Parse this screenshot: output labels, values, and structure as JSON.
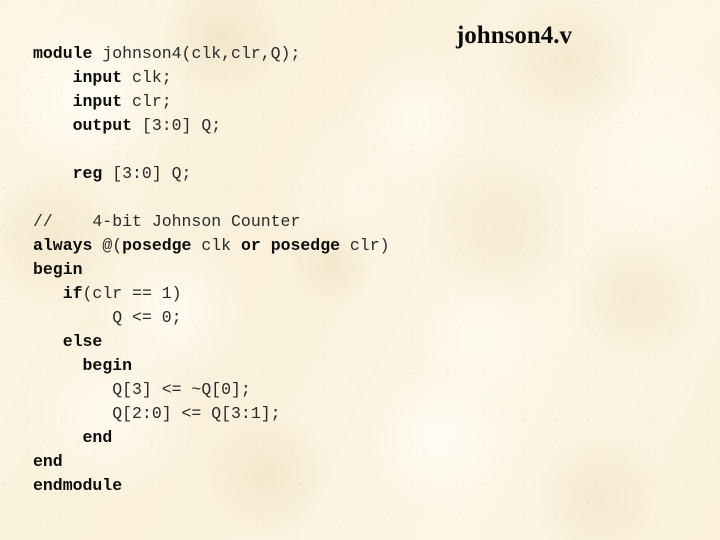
{
  "slide": {
    "title": "johnson4.v",
    "background_color": "#faf0db",
    "text_color": "#111111",
    "file_name": "johnson4.v",
    "language": "verilog"
  },
  "code": {
    "lines": [
      {
        "index": 0,
        "indent": "",
        "text": "module johnson4(clk,clr,Q);",
        "tokens": [
          {
            "t": "module",
            "bold": true
          },
          {
            "t": " johnson4(clk,clr,Q);",
            "bold": false
          }
        ]
      },
      {
        "index": 1,
        "indent": "    ",
        "text": "    input clk;",
        "tokens": [
          {
            "t": "    ",
            "bold": false
          },
          {
            "t": "input",
            "bold": true
          },
          {
            "t": " clk;",
            "bold": false
          }
        ]
      },
      {
        "index": 2,
        "indent": "    ",
        "text": "    input clr;",
        "tokens": [
          {
            "t": "    ",
            "bold": false
          },
          {
            "t": "input",
            "bold": true
          },
          {
            "t": " clr;",
            "bold": false
          }
        ]
      },
      {
        "index": 3,
        "indent": "    ",
        "text": "    output [3:0] Q;",
        "tokens": [
          {
            "t": "    ",
            "bold": false
          },
          {
            "t": "output",
            "bold": true
          },
          {
            "t": " [3:0] Q;",
            "bold": false
          }
        ]
      },
      {
        "index": 4,
        "indent": "",
        "text": "",
        "tokens": []
      },
      {
        "index": 5,
        "indent": "    ",
        "text": "    reg [3:0] Q;",
        "tokens": [
          {
            "t": "    ",
            "bold": false
          },
          {
            "t": "reg",
            "bold": true
          },
          {
            "t": " [3:0] Q;",
            "bold": false
          }
        ]
      },
      {
        "index": 6,
        "indent": "",
        "text": "",
        "tokens": []
      },
      {
        "index": 7,
        "indent": "",
        "text": "//    4-bit Johnson Counter",
        "tokens": [
          {
            "t": "//    4-bit Johnson Counter",
            "bold": false
          }
        ]
      },
      {
        "index": 8,
        "indent": "",
        "text": "always @(posedge clk or posedge clr)",
        "tokens": [
          {
            "t": "always",
            "bold": true
          },
          {
            "t": " @(",
            "bold": false
          },
          {
            "t": "posedge",
            "bold": true
          },
          {
            "t": " clk ",
            "bold": false
          },
          {
            "t": "or",
            "bold": true
          },
          {
            "t": " ",
            "bold": false
          },
          {
            "t": "posedge",
            "bold": true
          },
          {
            "t": " clr)",
            "bold": false
          }
        ]
      },
      {
        "index": 9,
        "indent": "",
        "text": "begin",
        "tokens": [
          {
            "t": "begin",
            "bold": true
          }
        ]
      },
      {
        "index": 10,
        "indent": "   ",
        "text": "   if(clr == 1)",
        "tokens": [
          {
            "t": "   ",
            "bold": false
          },
          {
            "t": "if",
            "bold": true
          },
          {
            "t": "(clr == 1)",
            "bold": false
          }
        ]
      },
      {
        "index": 11,
        "indent": "        ",
        "text": "        Q <= 0;",
        "tokens": [
          {
            "t": "        Q <= 0;",
            "bold": false
          }
        ]
      },
      {
        "index": 12,
        "indent": "   ",
        "text": "   else",
        "tokens": [
          {
            "t": "   ",
            "bold": false
          },
          {
            "t": "else",
            "bold": true
          }
        ]
      },
      {
        "index": 13,
        "indent": "     ",
        "text": "     begin",
        "tokens": [
          {
            "t": "     ",
            "bold": false
          },
          {
            "t": "begin",
            "bold": true
          }
        ]
      },
      {
        "index": 14,
        "indent": "        ",
        "text": "        Q[3] <= ~Q[0];",
        "tokens": [
          {
            "t": "        Q[3] <= ~Q[0];",
            "bold": false
          }
        ]
      },
      {
        "index": 15,
        "indent": "        ",
        "text": "        Q[2:0] <= Q[3:1];",
        "tokens": [
          {
            "t": "        Q[2:0] <= Q[3:1];",
            "bold": false
          }
        ]
      },
      {
        "index": 16,
        "indent": "     ",
        "text": "     end",
        "tokens": [
          {
            "t": "     ",
            "bold": false
          },
          {
            "t": "end",
            "bold": true
          }
        ]
      },
      {
        "index": 17,
        "indent": "",
        "text": "end",
        "tokens": [
          {
            "t": "end",
            "bold": true
          }
        ]
      },
      {
        "index": 18,
        "indent": "",
        "text": "endmodule",
        "tokens": [
          {
            "t": "endmodule",
            "bold": true
          }
        ]
      }
    ]
  }
}
